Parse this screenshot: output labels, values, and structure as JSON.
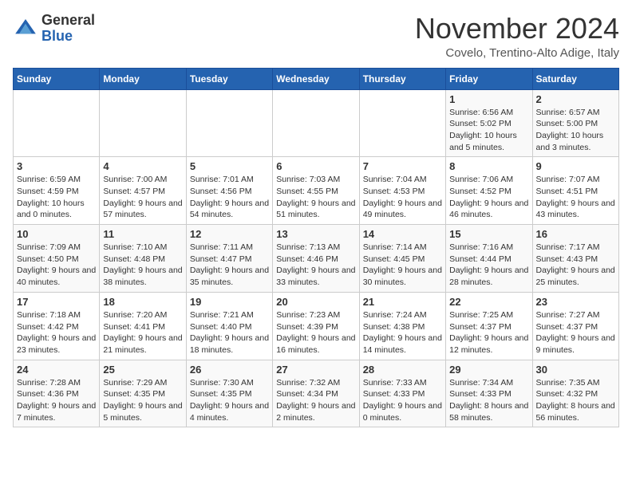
{
  "logo": {
    "general": "General",
    "blue": "Blue"
  },
  "title": "November 2024",
  "location": "Covelo, Trentino-Alto Adige, Italy",
  "days_header": [
    "Sunday",
    "Monday",
    "Tuesday",
    "Wednesday",
    "Thursday",
    "Friday",
    "Saturday"
  ],
  "weeks": [
    [
      {
        "day": "",
        "sunrise": "",
        "sunset": "",
        "daylight": ""
      },
      {
        "day": "",
        "sunrise": "",
        "sunset": "",
        "daylight": ""
      },
      {
        "day": "",
        "sunrise": "",
        "sunset": "",
        "daylight": ""
      },
      {
        "day": "",
        "sunrise": "",
        "sunset": "",
        "daylight": ""
      },
      {
        "day": "",
        "sunrise": "",
        "sunset": "",
        "daylight": ""
      },
      {
        "day": "1",
        "sunrise": "Sunrise: 6:56 AM",
        "sunset": "Sunset: 5:02 PM",
        "daylight": "Daylight: 10 hours and 5 minutes."
      },
      {
        "day": "2",
        "sunrise": "Sunrise: 6:57 AM",
        "sunset": "Sunset: 5:00 PM",
        "daylight": "Daylight: 10 hours and 3 minutes."
      }
    ],
    [
      {
        "day": "3",
        "sunrise": "Sunrise: 6:59 AM",
        "sunset": "Sunset: 4:59 PM",
        "daylight": "Daylight: 10 hours and 0 minutes."
      },
      {
        "day": "4",
        "sunrise": "Sunrise: 7:00 AM",
        "sunset": "Sunset: 4:57 PM",
        "daylight": "Daylight: 9 hours and 57 minutes."
      },
      {
        "day": "5",
        "sunrise": "Sunrise: 7:01 AM",
        "sunset": "Sunset: 4:56 PM",
        "daylight": "Daylight: 9 hours and 54 minutes."
      },
      {
        "day": "6",
        "sunrise": "Sunrise: 7:03 AM",
        "sunset": "Sunset: 4:55 PM",
        "daylight": "Daylight: 9 hours and 51 minutes."
      },
      {
        "day": "7",
        "sunrise": "Sunrise: 7:04 AM",
        "sunset": "Sunset: 4:53 PM",
        "daylight": "Daylight: 9 hours and 49 minutes."
      },
      {
        "day": "8",
        "sunrise": "Sunrise: 7:06 AM",
        "sunset": "Sunset: 4:52 PM",
        "daylight": "Daylight: 9 hours and 46 minutes."
      },
      {
        "day": "9",
        "sunrise": "Sunrise: 7:07 AM",
        "sunset": "Sunset: 4:51 PM",
        "daylight": "Daylight: 9 hours and 43 minutes."
      }
    ],
    [
      {
        "day": "10",
        "sunrise": "Sunrise: 7:09 AM",
        "sunset": "Sunset: 4:50 PM",
        "daylight": "Daylight: 9 hours and 40 minutes."
      },
      {
        "day": "11",
        "sunrise": "Sunrise: 7:10 AM",
        "sunset": "Sunset: 4:48 PM",
        "daylight": "Daylight: 9 hours and 38 minutes."
      },
      {
        "day": "12",
        "sunrise": "Sunrise: 7:11 AM",
        "sunset": "Sunset: 4:47 PM",
        "daylight": "Daylight: 9 hours and 35 minutes."
      },
      {
        "day": "13",
        "sunrise": "Sunrise: 7:13 AM",
        "sunset": "Sunset: 4:46 PM",
        "daylight": "Daylight: 9 hours and 33 minutes."
      },
      {
        "day": "14",
        "sunrise": "Sunrise: 7:14 AM",
        "sunset": "Sunset: 4:45 PM",
        "daylight": "Daylight: 9 hours and 30 minutes."
      },
      {
        "day": "15",
        "sunrise": "Sunrise: 7:16 AM",
        "sunset": "Sunset: 4:44 PM",
        "daylight": "Daylight: 9 hours and 28 minutes."
      },
      {
        "day": "16",
        "sunrise": "Sunrise: 7:17 AM",
        "sunset": "Sunset: 4:43 PM",
        "daylight": "Daylight: 9 hours and 25 minutes."
      }
    ],
    [
      {
        "day": "17",
        "sunrise": "Sunrise: 7:18 AM",
        "sunset": "Sunset: 4:42 PM",
        "daylight": "Daylight: 9 hours and 23 minutes."
      },
      {
        "day": "18",
        "sunrise": "Sunrise: 7:20 AM",
        "sunset": "Sunset: 4:41 PM",
        "daylight": "Daylight: 9 hours and 21 minutes."
      },
      {
        "day": "19",
        "sunrise": "Sunrise: 7:21 AM",
        "sunset": "Sunset: 4:40 PM",
        "daylight": "Daylight: 9 hours and 18 minutes."
      },
      {
        "day": "20",
        "sunrise": "Sunrise: 7:23 AM",
        "sunset": "Sunset: 4:39 PM",
        "daylight": "Daylight: 9 hours and 16 minutes."
      },
      {
        "day": "21",
        "sunrise": "Sunrise: 7:24 AM",
        "sunset": "Sunset: 4:38 PM",
        "daylight": "Daylight: 9 hours and 14 minutes."
      },
      {
        "day": "22",
        "sunrise": "Sunrise: 7:25 AM",
        "sunset": "Sunset: 4:37 PM",
        "daylight": "Daylight: 9 hours and 12 minutes."
      },
      {
        "day": "23",
        "sunrise": "Sunrise: 7:27 AM",
        "sunset": "Sunset: 4:37 PM",
        "daylight": "Daylight: 9 hours and 9 minutes."
      }
    ],
    [
      {
        "day": "24",
        "sunrise": "Sunrise: 7:28 AM",
        "sunset": "Sunset: 4:36 PM",
        "daylight": "Daylight: 9 hours and 7 minutes."
      },
      {
        "day": "25",
        "sunrise": "Sunrise: 7:29 AM",
        "sunset": "Sunset: 4:35 PM",
        "daylight": "Daylight: 9 hours and 5 minutes."
      },
      {
        "day": "26",
        "sunrise": "Sunrise: 7:30 AM",
        "sunset": "Sunset: 4:35 PM",
        "daylight": "Daylight: 9 hours and 4 minutes."
      },
      {
        "day": "27",
        "sunrise": "Sunrise: 7:32 AM",
        "sunset": "Sunset: 4:34 PM",
        "daylight": "Daylight: 9 hours and 2 minutes."
      },
      {
        "day": "28",
        "sunrise": "Sunrise: 7:33 AM",
        "sunset": "Sunset: 4:33 PM",
        "daylight": "Daylight: 9 hours and 0 minutes."
      },
      {
        "day": "29",
        "sunrise": "Sunrise: 7:34 AM",
        "sunset": "Sunset: 4:33 PM",
        "daylight": "Daylight: 8 hours and 58 minutes."
      },
      {
        "day": "30",
        "sunrise": "Sunrise: 7:35 AM",
        "sunset": "Sunset: 4:32 PM",
        "daylight": "Daylight: 8 hours and 56 minutes."
      }
    ]
  ]
}
